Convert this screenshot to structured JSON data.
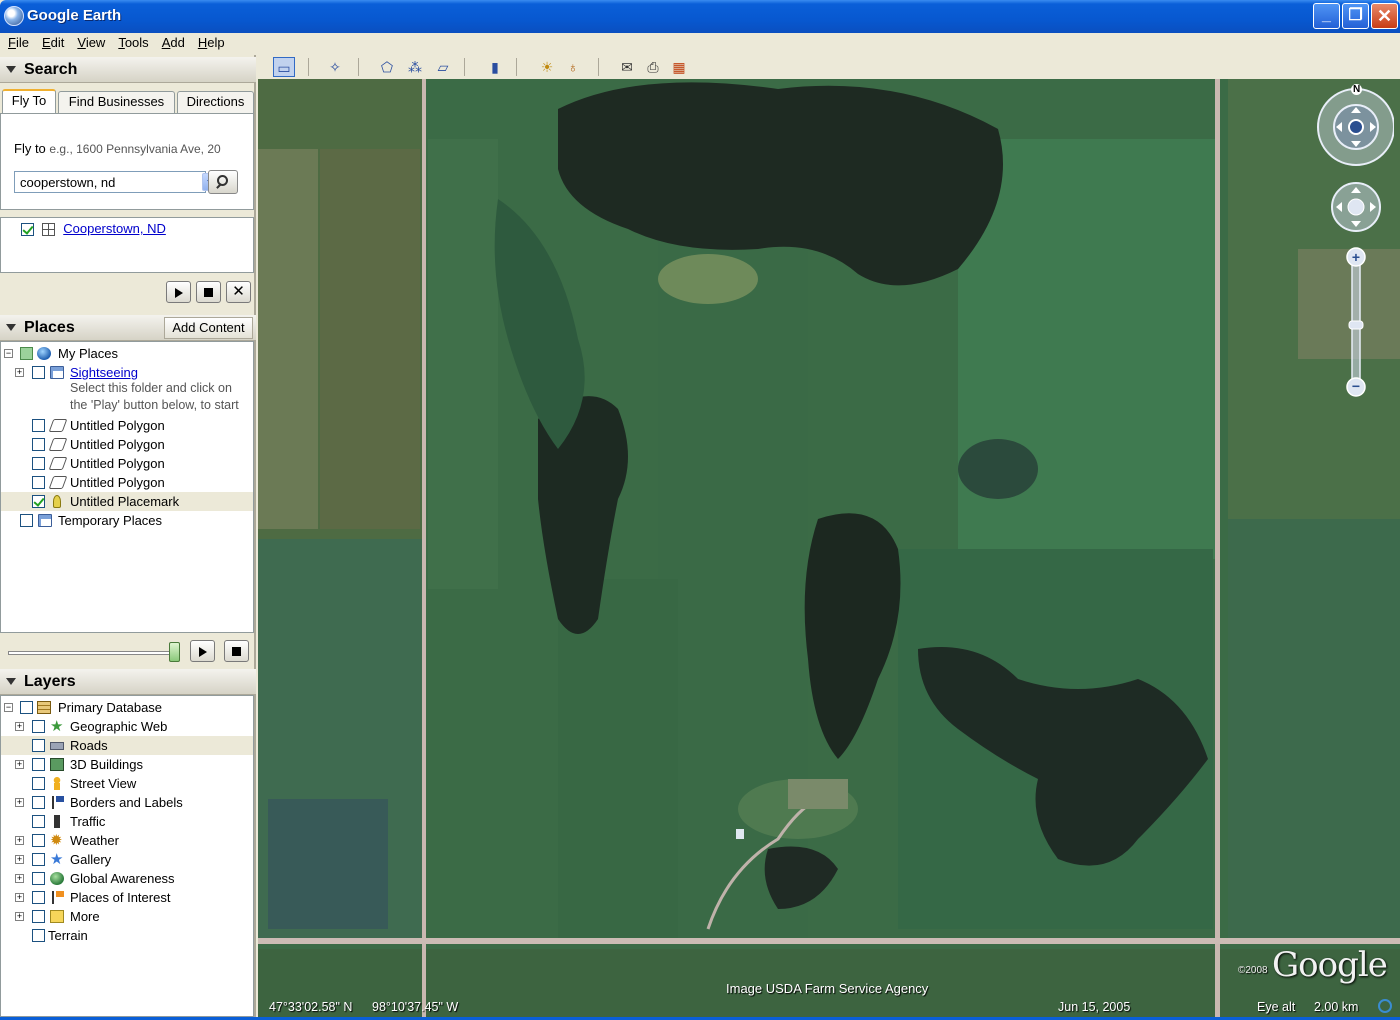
{
  "window": {
    "title": "Google Earth",
    "minimize": "_",
    "maximize": "❐",
    "close": "✕"
  },
  "menu": [
    "File",
    "Edit",
    "View",
    "Tools",
    "Add",
    "Help"
  ],
  "search": {
    "title": "Search",
    "tabs": [
      "Fly To",
      "Find Businesses",
      "Directions"
    ],
    "flyto_label": "Fly to",
    "flyto_hint": "e.g., 1600 Pennsylvania Ave, 20",
    "flyto_value": "cooperstown, nd",
    "result": "Cooperstown, ND"
  },
  "places": {
    "title": "Places",
    "add_content": "Add Content",
    "items": {
      "my_places": "My Places",
      "sightseeing": "Sightseeing",
      "sightseeing_desc_1": "Select this folder and click on",
      "sightseeing_desc_2": "the 'Play' button below, to start",
      "polygon_1": "Untitled Polygon",
      "polygon_2": "Untitled Polygon",
      "polygon_3": "Untitled Polygon",
      "polygon_4": "Untitled Polygon",
      "placemark": "Untitled Placemark",
      "temporary": "Temporary Places"
    }
  },
  "layers": {
    "title": "Layers",
    "items": {
      "primary": "Primary Database",
      "geographic_web": "Geographic Web",
      "roads": "Roads",
      "buildings": "3D Buildings",
      "street_view": "Street View",
      "borders": "Borders and Labels",
      "traffic": "Traffic",
      "weather": "Weather",
      "gallery": "Gallery",
      "global_awareness": "Global Awareness",
      "poi": "Places of Interest",
      "more": "More",
      "terrain": "Terrain"
    }
  },
  "map": {
    "attribution": "Image USDA Farm Service Agency",
    "latitude": "47°33'02.58\" N",
    "longitude": "98°10'37.45\" W",
    "date": "Jun 15, 2005",
    "eye_alt_label": "Eye alt",
    "eye_alt_value": "2.00 km",
    "logo": "Google",
    "copyright": "©2008",
    "compass_north": "N"
  },
  "colors": {
    "title_bar": "#0858d0",
    "panel": "#ece9d8",
    "link": "#0000cc"
  }
}
